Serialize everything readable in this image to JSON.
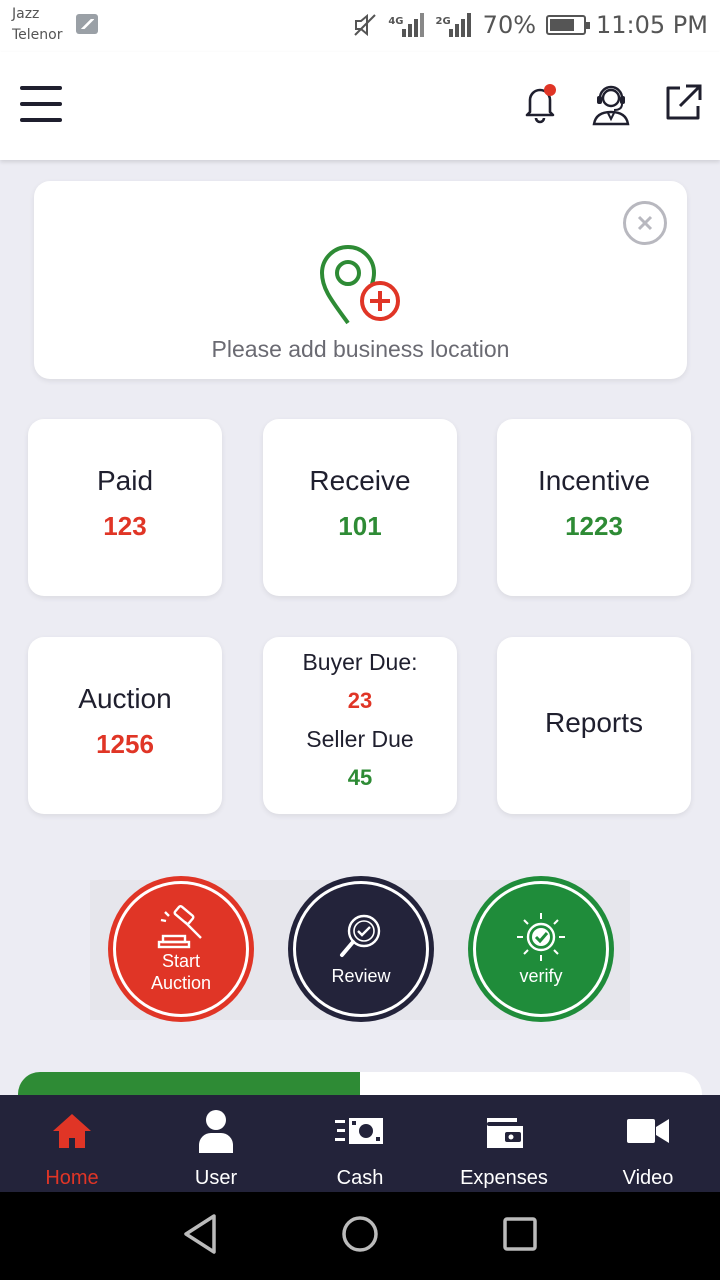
{
  "status_bar": {
    "carrier_line1": "Jazz",
    "carrier_line2": "Telenor",
    "net1": "4G",
    "net2": "2G",
    "battery": "70%",
    "time": "11:05 PM"
  },
  "app_bar": {
    "menu_icon": "hamburger-icon",
    "notification_icon": "bell-icon",
    "support_icon": "customer-support-icon",
    "share_icon": "external-link-icon"
  },
  "location_card": {
    "message": "Please add business location",
    "icon": "add-location-icon"
  },
  "stats": {
    "paid": {
      "label": "Paid",
      "value": "123"
    },
    "receive": {
      "label": "Receive",
      "value": "101"
    },
    "incentive": {
      "label": "Incentive",
      "value": "1223"
    },
    "auction": {
      "label": "Auction",
      "value": "1256"
    },
    "dues": {
      "buyer_label": "Buyer Due:",
      "buyer_value": "23",
      "seller_label": "Seller Due",
      "seller_value": "45"
    },
    "reports": {
      "label": "Reports"
    }
  },
  "actions": {
    "start_auction": {
      "line1": "Start",
      "line2": "Auction"
    },
    "review": {
      "label": "Review"
    },
    "verify": {
      "label": "verify"
    }
  },
  "progress": {
    "fraction": 0.5
  },
  "bottom_nav": {
    "items": [
      {
        "label": "Home",
        "icon": "home-icon",
        "active": true
      },
      {
        "label": "User",
        "icon": "user-icon",
        "active": false
      },
      {
        "label": "Cash",
        "icon": "cash-icon",
        "active": false
      },
      {
        "label": "Expenses",
        "icon": "wallet-icon",
        "active": false
      },
      {
        "label": "Video",
        "icon": "video-camera-icon",
        "active": false
      }
    ]
  },
  "colors": {
    "red": "#e03526",
    "green": "#2e8b35",
    "navy": "#23233a",
    "background": "#ececf3"
  }
}
